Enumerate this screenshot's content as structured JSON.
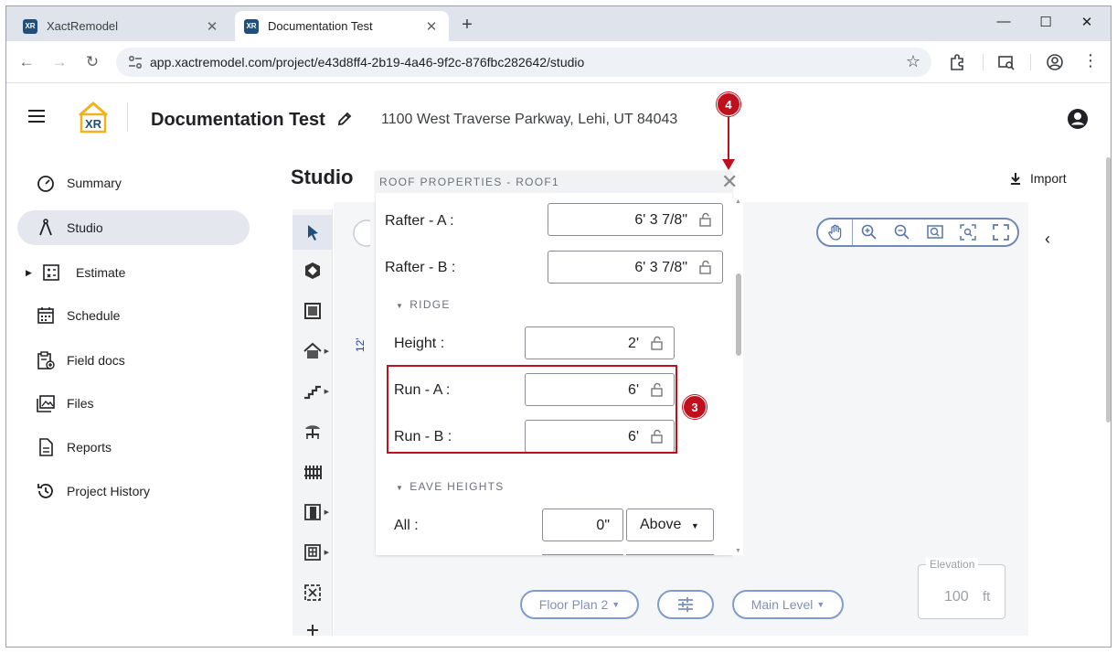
{
  "browser": {
    "tabs": [
      {
        "title": "XactRemodel",
        "favicon": "XR"
      },
      {
        "title": "Documentation Test",
        "favicon": "XR"
      }
    ],
    "url": "app.xactremodel.com/project/e43d8ff4-2b19-4a46-9f2c-876fbc282642/studio"
  },
  "header": {
    "project_title": "Documentation Test",
    "address": "1100 West Traverse Parkway, Lehi, UT 84043",
    "logo_text": "XR"
  },
  "sidebar": {
    "items": [
      {
        "label": "Summary"
      },
      {
        "label": "Studio"
      },
      {
        "label": "Estimate"
      },
      {
        "label": "Schedule"
      },
      {
        "label": "Field docs"
      },
      {
        "label": "Files"
      },
      {
        "label": "Reports"
      },
      {
        "label": "Project History"
      }
    ]
  },
  "studio": {
    "title": "Studio",
    "import_label": "Import",
    "dimension_label": "12'"
  },
  "panel": {
    "title": "ROOF PROPERTIES - ROOF1",
    "rafter_a": {
      "label": "Rafter - A :",
      "value": "6' 3 7/8\""
    },
    "rafter_b": {
      "label": "Rafter - B :",
      "value": "6' 3 7/8\""
    },
    "ridge_section": "RIDGE",
    "height": {
      "label": "Height :",
      "value": "2'"
    },
    "run_a": {
      "label": "Run - A :",
      "value": "6'"
    },
    "run_b": {
      "label": "Run - B :",
      "value": "6'"
    },
    "eave_section": "EAVE HEIGHTS",
    "all": {
      "label": "All :",
      "value": "0\"",
      "select": "Above"
    }
  },
  "bottom": {
    "floor_plan": "Floor Plan 2",
    "main_level": "Main Level",
    "elevation_legend": "Elevation",
    "elevation_value": "100",
    "elevation_unit": "ft"
  },
  "annotations": {
    "badge_3": "3",
    "badge_4": "4",
    "color": "#c0101e"
  }
}
